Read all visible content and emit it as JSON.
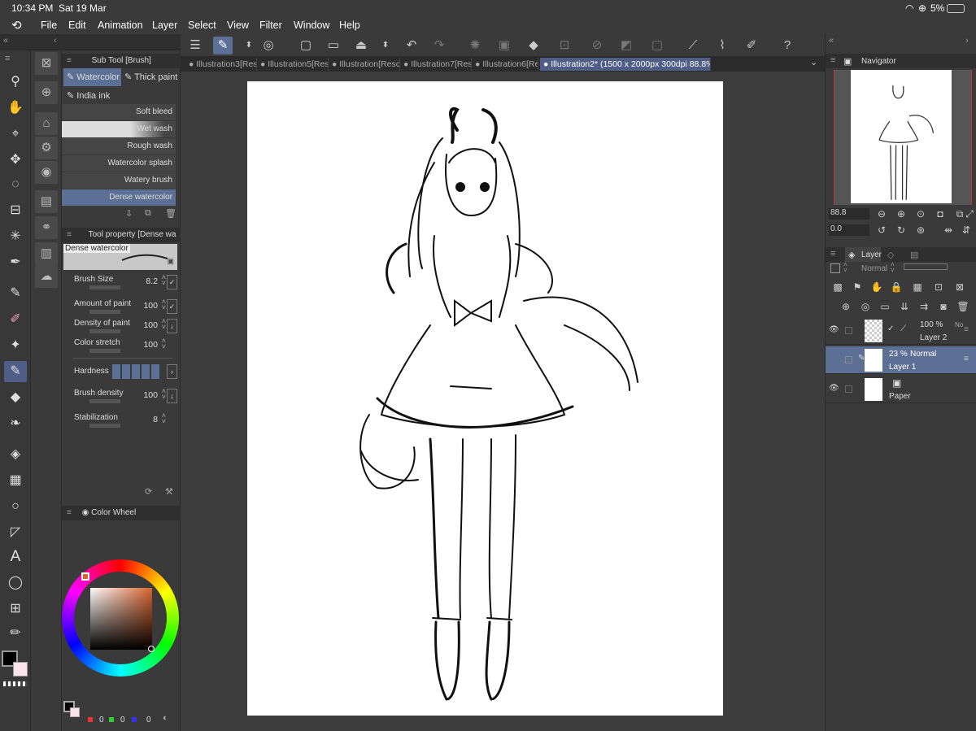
{
  "status": {
    "time": "10:34 PM",
    "date": "Sat 19 Mar",
    "battery": "5%"
  },
  "menu": [
    "File",
    "Edit",
    "Animation",
    "Layer",
    "Select",
    "View",
    "Filter",
    "Window",
    "Help"
  ],
  "tabs": [
    {
      "label": "Illustration3[Res",
      "active": false
    },
    {
      "label": "Illustration5[Res",
      "active": false
    },
    {
      "label": "Illustration[Resc",
      "active": false
    },
    {
      "label": "Illustration7[Res",
      "active": false
    },
    {
      "label": "Illustration6[Re",
      "active": false
    },
    {
      "label": "Illustration2* (1500 x 2000px 300dpi 88.8%)",
      "active": true
    }
  ],
  "subtool": {
    "title": "Sub Tool [Brush]",
    "groups": [
      "Watercolor",
      "Thick paint",
      "India ink"
    ],
    "brushes": [
      "Soft bleed",
      "Wet wash",
      "Rough wash",
      "Watercolor splash",
      "Watery brush",
      "Dense watercolor"
    ]
  },
  "toolprop": {
    "title": "Tool property [Dense wa",
    "brush_name": "Dense watercolor",
    "props": [
      {
        "label": "Brush Size",
        "value": "8.2"
      },
      {
        "label": "Amount of paint",
        "value": "100"
      },
      {
        "label": "Density of paint",
        "value": "100"
      },
      {
        "label": "Color stretch",
        "value": "100"
      },
      {
        "label": "Hardness",
        "value": ""
      },
      {
        "label": "Brush density",
        "value": "100"
      },
      {
        "label": "Stabilization",
        "value": "8"
      }
    ]
  },
  "colorwheel": {
    "title": "Color Wheel",
    "rgb": [
      "0",
      "0",
      "0"
    ],
    "main_color": "#000000",
    "sub_color": "#fbe3ec"
  },
  "navigator": {
    "title": "Navigator",
    "zoom": "88.8",
    "rotation": "0.0"
  },
  "layers": {
    "title": "Layer",
    "blend": "Normal",
    "items": [
      {
        "opacity": "100 %",
        "mode": "No",
        "name": "Layer 2"
      },
      {
        "opacity": "23 %",
        "mode": "Normal",
        "name": "Layer 1"
      },
      {
        "opacity": "",
        "mode": "",
        "name": "Paper"
      }
    ]
  }
}
